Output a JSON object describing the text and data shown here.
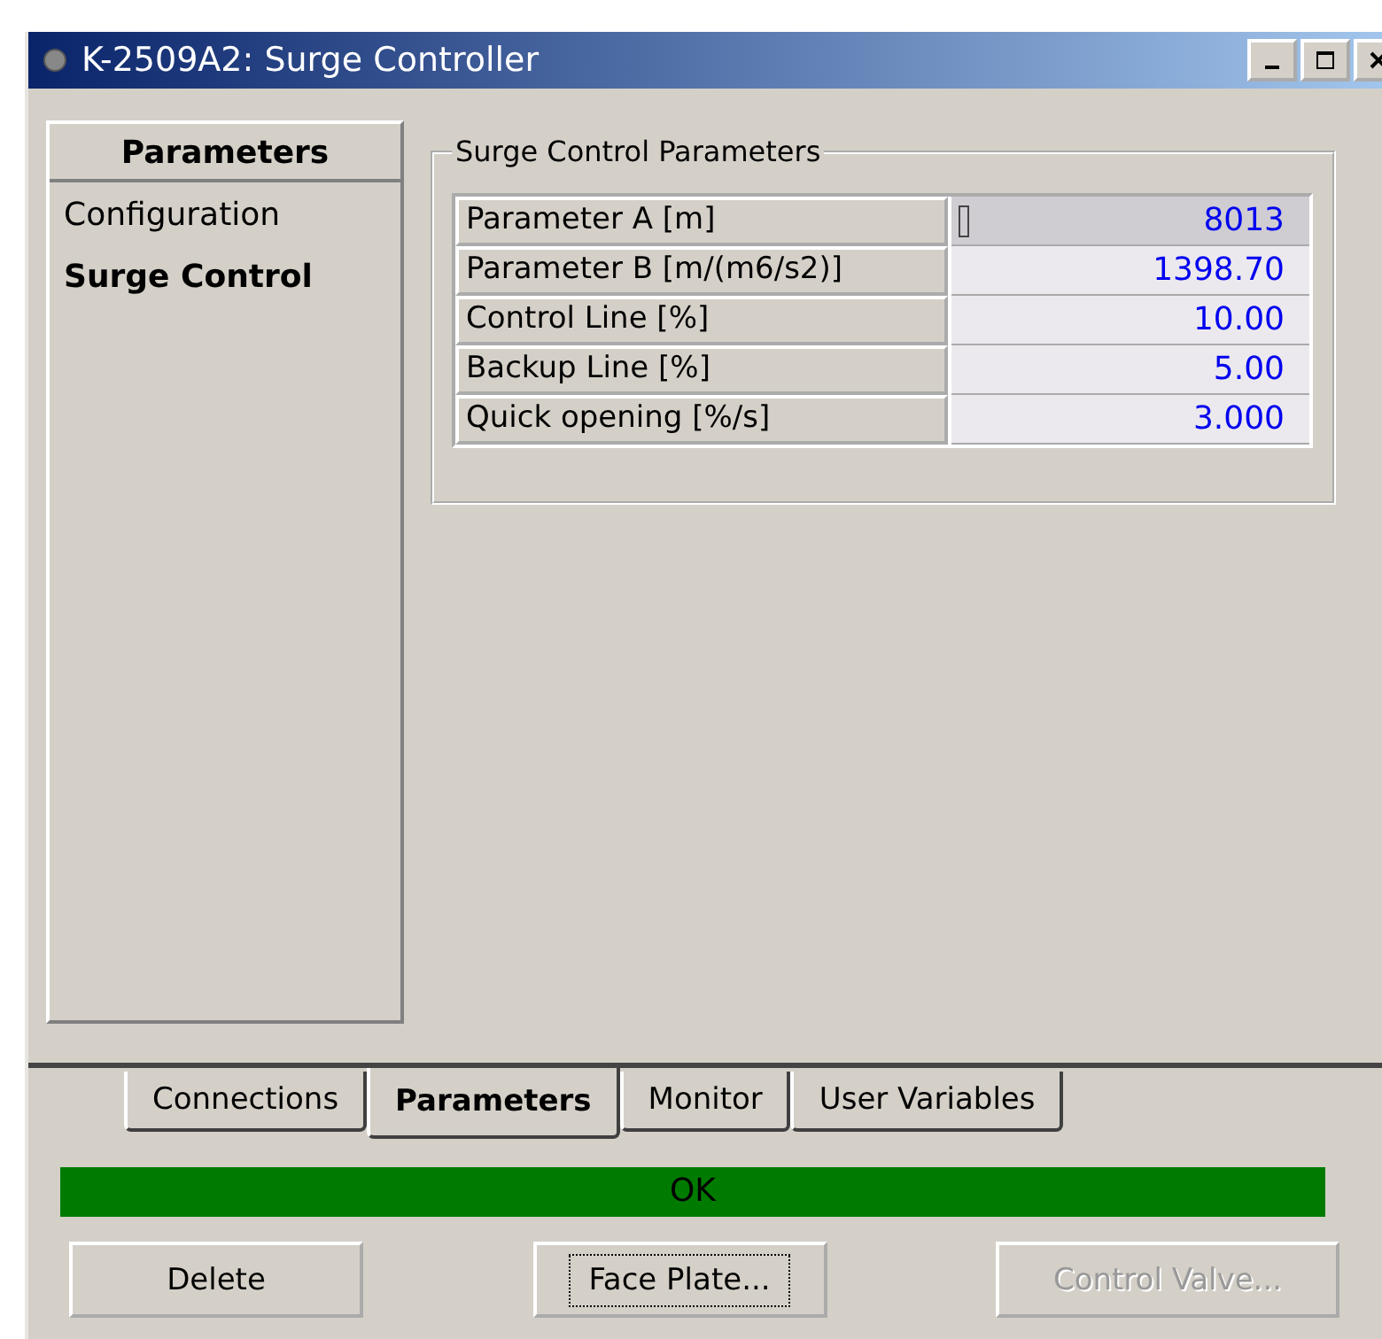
{
  "window": {
    "title": "K-2509A2: Surge Controller"
  },
  "sidebar": {
    "heading": "Parameters",
    "items": [
      {
        "label": "Configuration",
        "selected": false
      },
      {
        "label": "Surge Control",
        "selected": true
      }
    ]
  },
  "group": {
    "title": "Surge Control Parameters",
    "rows": [
      {
        "label": "Parameter A [m]",
        "value": "8013",
        "selected": true
      },
      {
        "label": "Parameter B [m/(m6/s2)]",
        "value": "1398.70",
        "selected": false
      },
      {
        "label": "Control Line [%]",
        "value": "10.00",
        "selected": false
      },
      {
        "label": "Backup Line [%]",
        "value": "5.00",
        "selected": false
      },
      {
        "label": "Quick opening [%/s]",
        "value": "3.000",
        "selected": false
      }
    ]
  },
  "tabs": [
    {
      "label": "Connections",
      "selected": false
    },
    {
      "label": "Parameters",
      "selected": true
    },
    {
      "label": "Monitor",
      "selected": false
    },
    {
      "label": "User Variables",
      "selected": false
    }
  ],
  "status": {
    "text": "OK",
    "color": "#007b00"
  },
  "buttons": [
    {
      "label": "Delete",
      "disabled": false,
      "focused": false
    },
    {
      "label": "Face Plate...",
      "disabled": false,
      "focused": true
    },
    {
      "label": "Control Valve...",
      "disabled": true,
      "focused": false
    }
  ]
}
